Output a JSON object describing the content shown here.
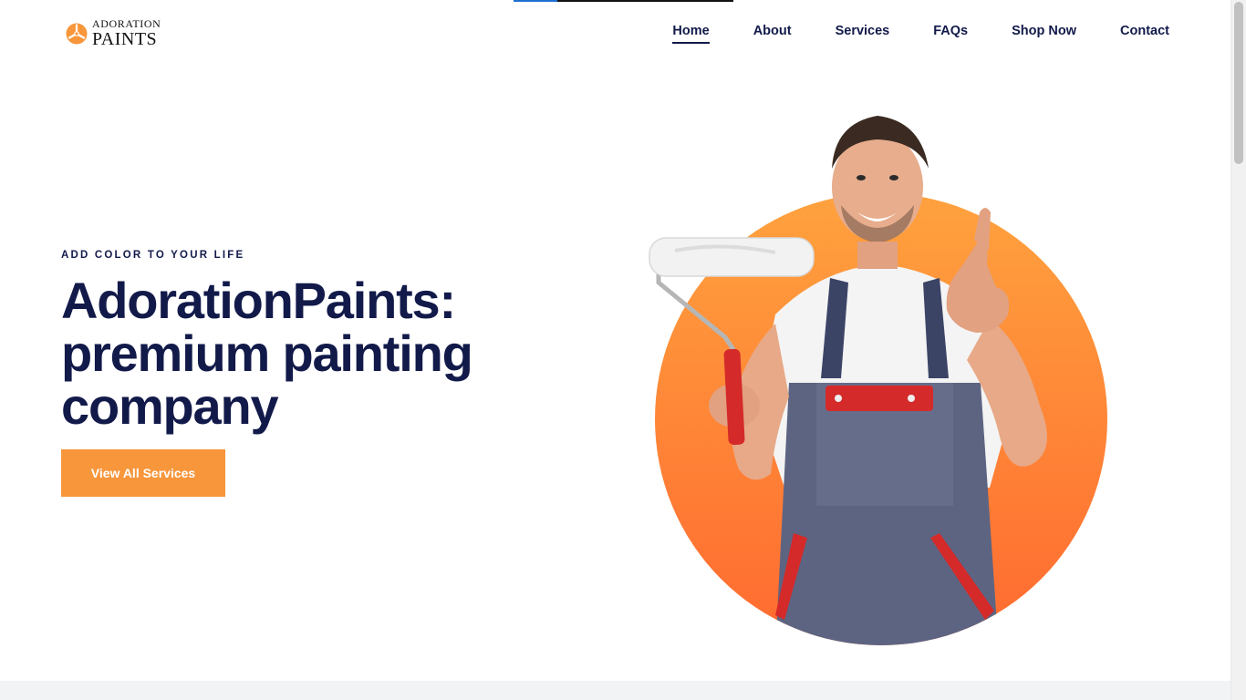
{
  "brand": {
    "name_line1": "ADORATION",
    "name_line2": "PAINTS",
    "accent_color": "#f7963b"
  },
  "nav": {
    "items": [
      {
        "label": "Home",
        "active": true
      },
      {
        "label": "About",
        "active": false
      },
      {
        "label": "Services",
        "active": false
      },
      {
        "label": "FAQs",
        "active": false
      },
      {
        "label": "Shop Now",
        "active": false
      },
      {
        "label": "Contact",
        "active": false
      }
    ]
  },
  "hero": {
    "eyebrow": "ADD COLOR TO YOUR LIFE",
    "title_line1": "AdorationPaints:",
    "title_line2": "premium painting",
    "title_line3": "company",
    "cta_label": "View All Services",
    "image": "painter-with-roller-thumbs-up",
    "circle_color_top": "#ffa23e",
    "circle_color_bottom": "#ff6a30",
    "text_color": "#121a4a"
  },
  "page_progress": 0.2,
  "icons": {
    "logo": "paint-blade-logo-icon"
  }
}
